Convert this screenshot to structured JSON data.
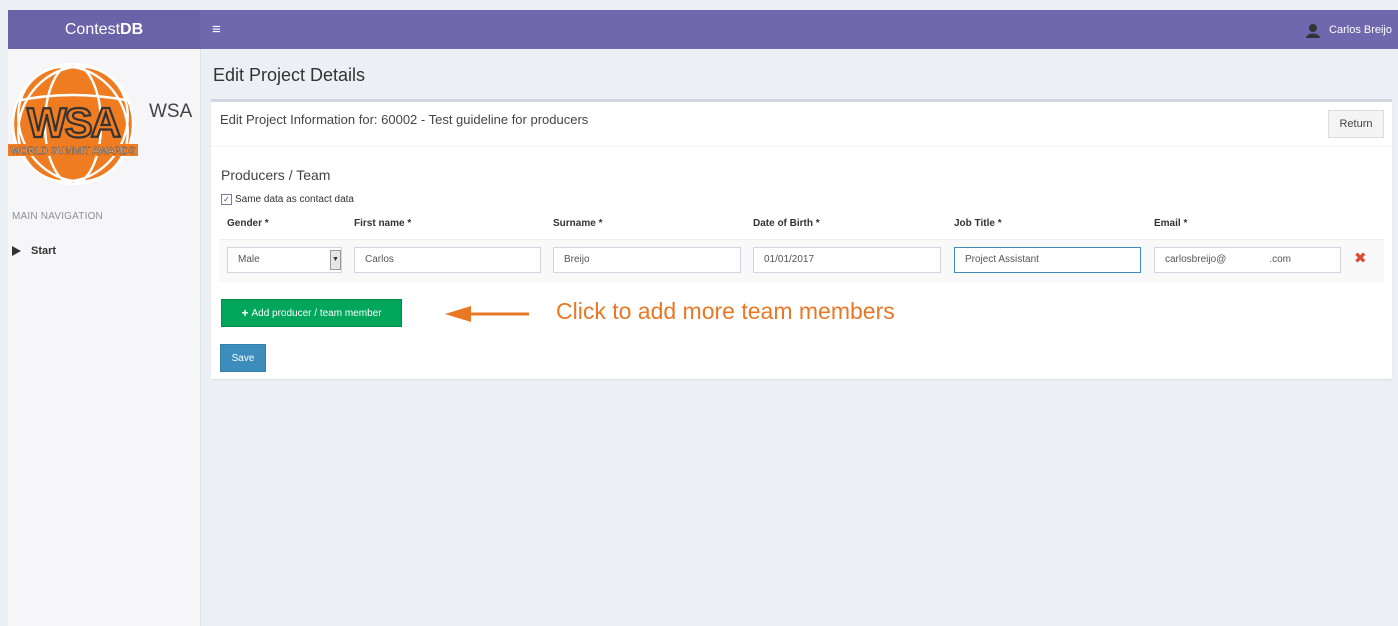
{
  "topbar": {
    "brand_prefix": "Contest",
    "brand_bold": "DB",
    "menu_icon": "hamburger-icon",
    "user_name": "Carlos Breijo",
    "user_icon": "user-avatar-icon"
  },
  "sidebar": {
    "logo_text": "WSA",
    "logo_caption": "WORLD SUMMIT AWARDS",
    "nav_header": "MAIN NAVIGATION",
    "items": [
      {
        "label": "Start",
        "icon": "triangle-right-icon"
      }
    ]
  },
  "main": {
    "page_title": "Edit Project Details",
    "box_title": "Edit Project Information for: 60002 - Test guideline for producers",
    "return_label": "Return",
    "section_title": "Producers / Team",
    "same_data_label": "Same data as contact data",
    "same_data_checked": true,
    "columns": [
      "Gender *",
      "First name *",
      "Surname *",
      "Date of Birth *",
      "Job Title *",
      "Email *"
    ],
    "row": {
      "gender": "Male",
      "first_name": "Carlos",
      "surname": "Breijo",
      "dob": "01/01/2017",
      "job_title": "Project Assistant",
      "email_user": "carlosbreijo@",
      "email_domain": ".com"
    },
    "add_label": "Add producer / team member",
    "save_label": "Save"
  },
  "annotation": {
    "text": "Click to add more team members",
    "color": "#e87824"
  },
  "colors": {
    "topbar": "#6f68ae",
    "success": "#00a65a",
    "primary": "#3c8dbc",
    "danger": "#dd4b39"
  }
}
